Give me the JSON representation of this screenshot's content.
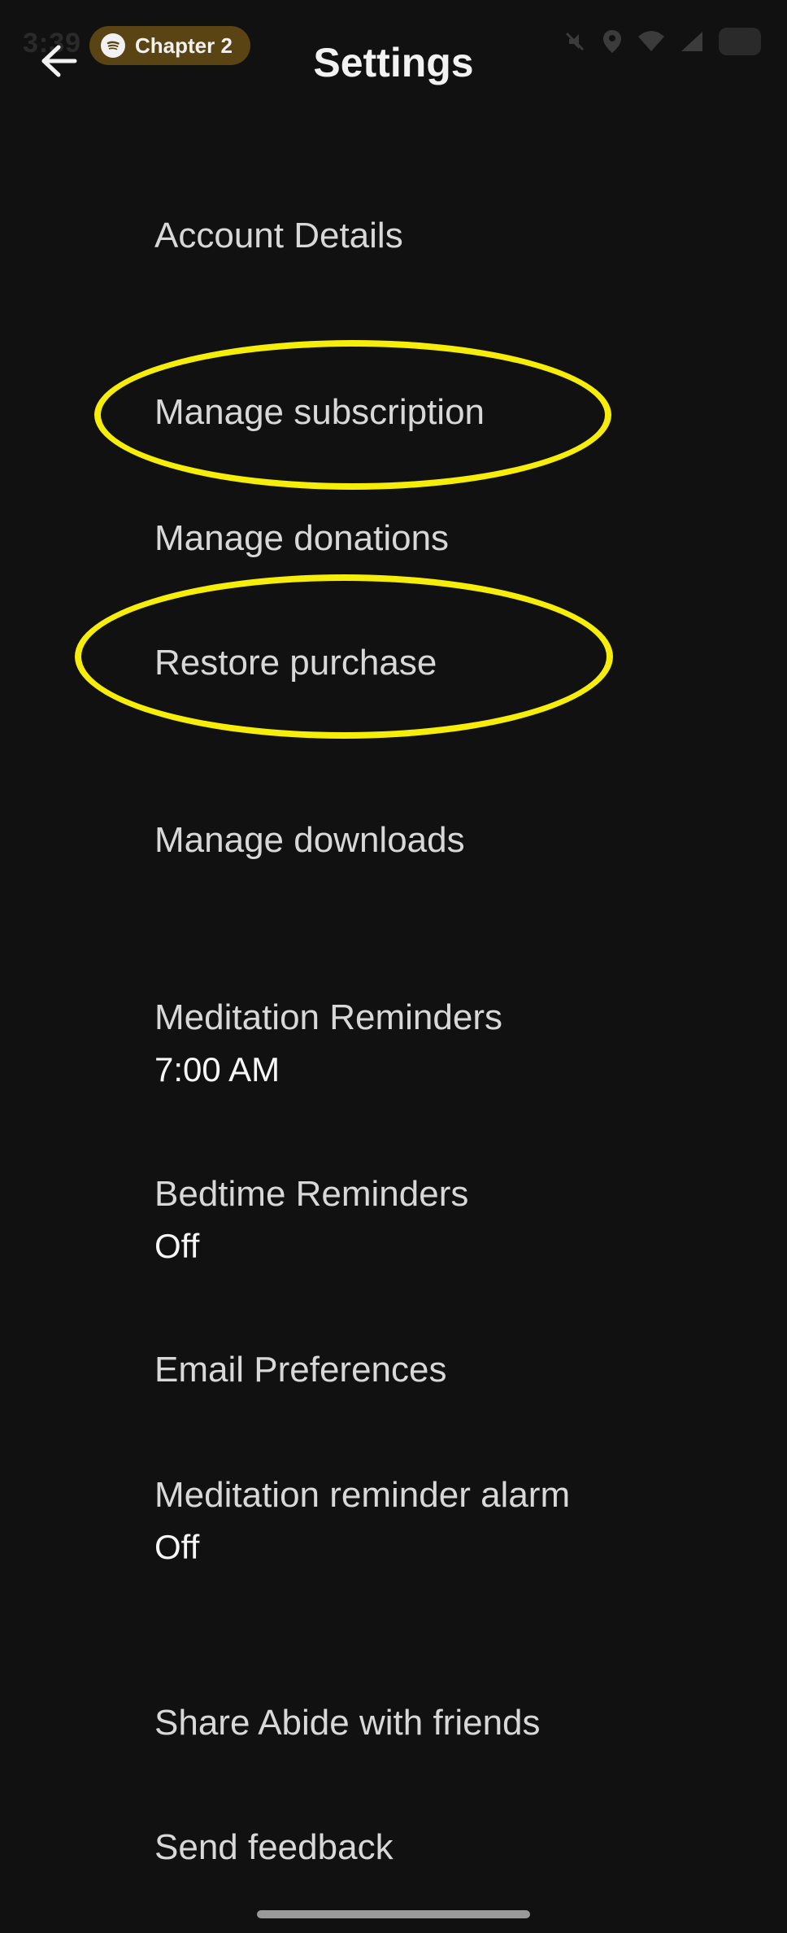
{
  "status_bar": {
    "time": "3:39",
    "now_playing": {
      "icon": "spotify-icon",
      "label": "Chapter 2"
    },
    "icons": [
      "mute-icon",
      "location-icon",
      "wifi-icon",
      "signal-icon",
      "battery-icon"
    ]
  },
  "app_bar": {
    "back_icon": "arrow-left-icon",
    "title": "Settings"
  },
  "settings": {
    "account_details": {
      "label": "Account Details"
    },
    "manage_subscription": {
      "label": "Manage subscription"
    },
    "manage_donations": {
      "label": "Manage donations"
    },
    "restore_purchase": {
      "label": "Restore purchase"
    },
    "manage_downloads": {
      "label": "Manage downloads"
    },
    "meditation_reminders": {
      "label": "Meditation Reminders",
      "value": "7:00 AM"
    },
    "bedtime_reminders": {
      "label": "Bedtime Reminders",
      "value": "Off"
    },
    "email_preferences": {
      "label": "Email Preferences"
    },
    "meditation_reminder_alarm": {
      "label": "Meditation reminder alarm",
      "value": "Off"
    },
    "share_abide": {
      "label": "Share Abide with friends"
    },
    "send_feedback": {
      "label": "Send feedback"
    }
  },
  "annotations": {
    "highlight_color": "#f6ee08",
    "highlighted_items": [
      "manage_subscription",
      "restore_purchase"
    ]
  },
  "colors": {
    "background": "#111111",
    "label_text": "#d8d8d8",
    "value_text": "#f6f6f6",
    "now_playing_pill": "#5a4413"
  }
}
